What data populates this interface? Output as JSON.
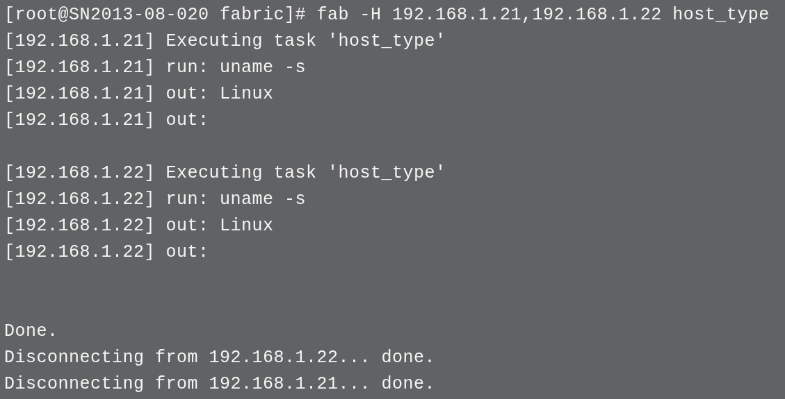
{
  "terminal": {
    "lines": [
      {
        "kind": "text",
        "text": "[root@SN2013-08-020 fabric]# fab -H 192.168.1.21,192.168.1.22 host_type"
      },
      {
        "kind": "text",
        "text": "[192.168.1.21] Executing task 'host_type'"
      },
      {
        "kind": "text",
        "text": "[192.168.1.21] run: uname -s"
      },
      {
        "kind": "text",
        "text": "[192.168.1.21] out: Linux"
      },
      {
        "kind": "text",
        "text": "[192.168.1.21] out:"
      },
      {
        "kind": "blank"
      },
      {
        "kind": "text",
        "text": "[192.168.1.22] Executing task 'host_type'"
      },
      {
        "kind": "text",
        "text": "[192.168.1.22] run: uname -s"
      },
      {
        "kind": "text",
        "text": "[192.168.1.22] out: Linux"
      },
      {
        "kind": "text",
        "text": "[192.168.1.22] out:"
      },
      {
        "kind": "blank"
      },
      {
        "kind": "blank"
      },
      {
        "kind": "text",
        "text": "Done."
      },
      {
        "kind": "text",
        "text": "Disconnecting from 192.168.1.22... done."
      },
      {
        "kind": "text",
        "text": "Disconnecting from 192.168.1.21... done."
      }
    ]
  }
}
